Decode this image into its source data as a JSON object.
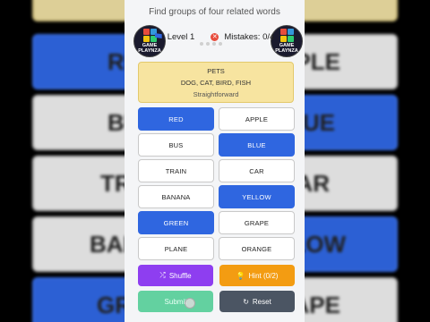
{
  "header": {
    "instruction": "Find groups of four related words",
    "level": "Level 1",
    "mistakes": "Mistakes: 0/4",
    "logo_text": "GAME PLAYNZA"
  },
  "solved_group": {
    "category": "PETS",
    "words": "DOG, CAT, BIRD, FISH",
    "difficulty": "Straightforward"
  },
  "words": [
    {
      "label": "RED",
      "selected": true
    },
    {
      "label": "APPLE",
      "selected": false
    },
    {
      "label": "BUS",
      "selected": false
    },
    {
      "label": "BLUE",
      "selected": true
    },
    {
      "label": "TRAIN",
      "selected": false
    },
    {
      "label": "CAR",
      "selected": false
    },
    {
      "label": "BANANA",
      "selected": false
    },
    {
      "label": "YELLOW",
      "selected": true
    },
    {
      "label": "GREEN",
      "selected": true
    },
    {
      "label": "GRAPE",
      "selected": false
    },
    {
      "label": "PLANE",
      "selected": false
    },
    {
      "label": "ORANGE",
      "selected": false
    }
  ],
  "buttons": {
    "shuffle": "Shuffle",
    "hint": "Hint (0/2)",
    "submit": "Submit",
    "reset": "Reset"
  },
  "background_words": [
    "RE",
    "PPLE",
    "BU",
    "BLUE",
    "TRA",
    "CAR",
    "BANA",
    "LLOW",
    "GRE",
    "RAPE"
  ],
  "colors": {
    "selected": "#2f66e0",
    "solved": "#f7e4a0",
    "shuffle": "#8e3ef0",
    "hint": "#f39c12",
    "submit": "#63d1a0",
    "reset": "#4b5563"
  }
}
